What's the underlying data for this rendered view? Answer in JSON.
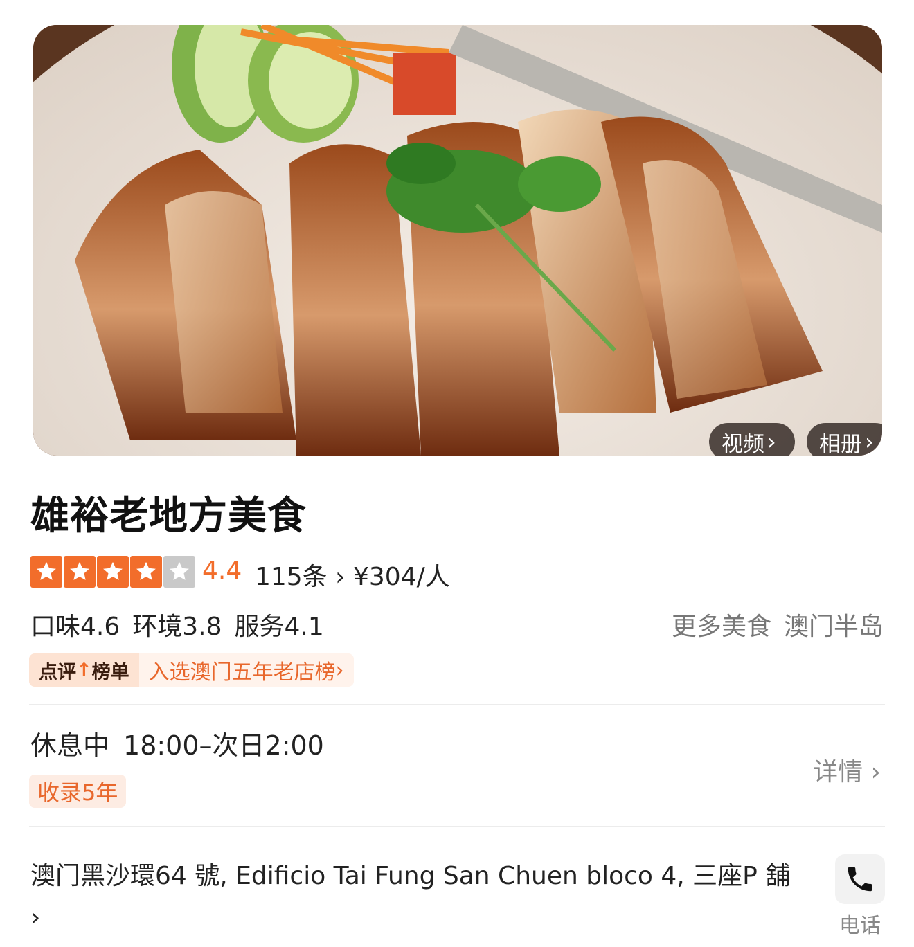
{
  "hero": {
    "video_label": "视频",
    "album_label": "相册",
    "chevron": "›"
  },
  "shop": {
    "name": "雄裕老地方美食",
    "star_rating": 4,
    "star_max": 5,
    "rating": "4.4",
    "reviews": "115条",
    "price": "¥304/人",
    "subscores": [
      "口味4.6",
      "环境3.8",
      "服务4.1"
    ],
    "more_food": [
      "更多美食",
      "澳门半岛"
    ]
  },
  "ranking": {
    "tag_left": "点评",
    "tag_right": "榜单",
    "text": "入选澳门五年老店榜"
  },
  "hours": {
    "status": "休息中",
    "time": "18:00–次日2:00",
    "years_badge": "收录5年",
    "detail_label": "详情"
  },
  "address": {
    "text": "澳门黑沙環64 號, Edificio Tai Fung San Chuen bloco 4, 三座P 舖",
    "phone_label": "电话",
    "phone_icon": "phone-icon"
  },
  "colors": {
    "accent": "#f26d2b",
    "star_off": "#c9c9c9",
    "muted": "#888888"
  }
}
